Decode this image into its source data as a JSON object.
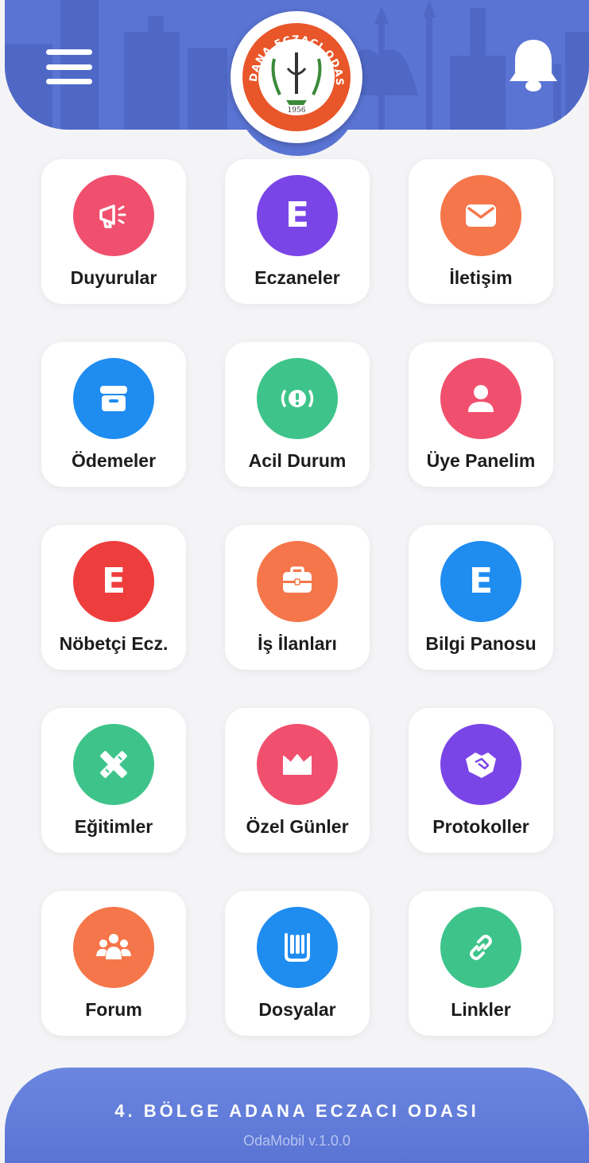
{
  "header": {
    "menu_icon": "hamburger-icon",
    "bell_icon": "bell-icon",
    "logo": {
      "text": "ADANA ECZACI ODASI",
      "year": "1956"
    }
  },
  "colors": {
    "header": "#5a74d4",
    "background": "#f4f4f6"
  },
  "tiles": [
    {
      "label": "Duyurular",
      "icon": "megaphone-icon",
      "color": "#f0506e"
    },
    {
      "label": "Eczaneler",
      "icon": "letter-e-icon",
      "color": "#7a45e6"
    },
    {
      "label": "İletişim",
      "icon": "envelope-icon",
      "color": "#f5764a"
    },
    {
      "label": "Ödemeler",
      "icon": "archive-box-icon",
      "color": "#1f8cf0"
    },
    {
      "label": "Acil Durum",
      "icon": "alert-icon",
      "color": "#3ec48a"
    },
    {
      "label": "Üye Panelim",
      "icon": "user-icon",
      "color": "#f0506e"
    },
    {
      "label": "Nöbetçi Ecz.",
      "icon": "letter-e-icon",
      "color": "#ee3d3d"
    },
    {
      "label": "İş İlanları",
      "icon": "briefcase-icon",
      "color": "#f5764a"
    },
    {
      "label": "Bilgi Panosu",
      "icon": "letter-e-icon",
      "color": "#1f8cf0"
    },
    {
      "label": "Eğitimler",
      "icon": "pencil-ruler-icon",
      "color": "#3ec48a"
    },
    {
      "label": "Özel Günler",
      "icon": "crown-icon",
      "color": "#f0506e"
    },
    {
      "label": "Protokoller",
      "icon": "handshake-icon",
      "color": "#7a45e6"
    },
    {
      "label": "Forum",
      "icon": "users-icon",
      "color": "#f5764a"
    },
    {
      "label": "Dosyalar",
      "icon": "book-icon",
      "color": "#1f8cf0"
    },
    {
      "label": "Linkler",
      "icon": "link-icon",
      "color": "#3ec48a"
    }
  ],
  "footer": {
    "org": "4. BÖLGE ADANA ECZACI ODASI",
    "version": "OdaMobil v.1.0.0"
  }
}
